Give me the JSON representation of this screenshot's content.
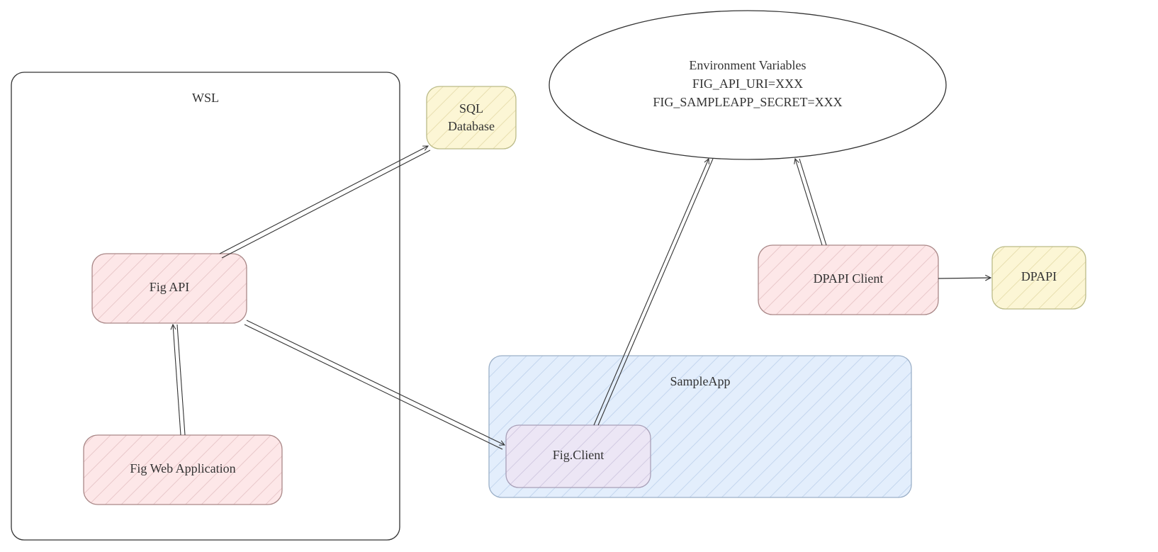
{
  "nodes": {
    "wsl": {
      "label": "WSL"
    },
    "fig_api": {
      "label": "Fig API"
    },
    "fig_web": {
      "label": "Fig Web Application"
    },
    "sql_db_l1": "SQL",
    "sql_db_l2": "Database",
    "env_l1": "Environment Variables",
    "env_l2": "FIG_API_URI=XXX",
    "env_l3": "FIG_SAMPLEAPP_SECRET=XXX",
    "sampleapp": {
      "label": "SampleApp"
    },
    "fig_client": {
      "label": "Fig.Client"
    },
    "dpapi_client": {
      "label": "DPAPI Client"
    },
    "dpapi": {
      "label": "DPAPI"
    }
  },
  "colors": {
    "pink_fill": "#fde7e8",
    "pink_stroke": "#c0a0a0",
    "yellow_fill": "#fcf6d5",
    "yellow_stroke": "#b8b080",
    "blue_fill": "#e3eefc",
    "blue_stroke": "#9cb0c8",
    "purple_fill": "#ece6f5",
    "purple_stroke": "#a8a0b8",
    "ink": "#333333"
  }
}
